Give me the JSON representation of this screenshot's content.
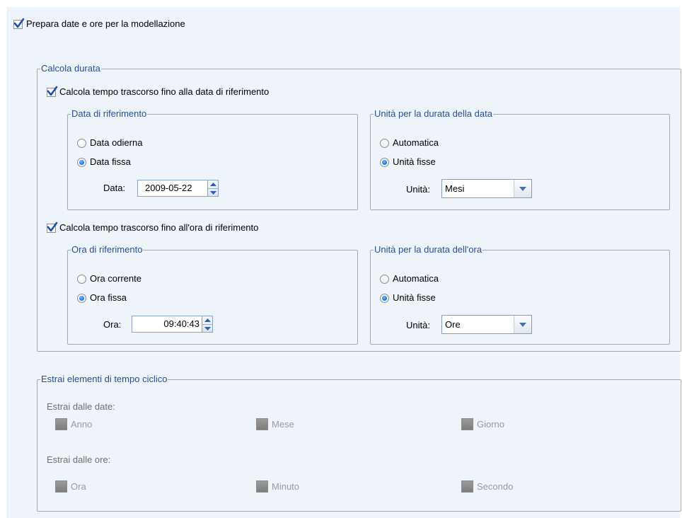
{
  "prepare": {
    "label": "Prepara date e ore per la modellazione",
    "checked": true
  },
  "duration": {
    "legend": "Calcola durata",
    "date_check": {
      "label": "Calcola tempo trascorso fino alla data di riferimento",
      "checked": true
    },
    "ref_date": {
      "legend": "Data di riferimento",
      "opt_today": "Data odierna",
      "opt_fixed": "Data fissa",
      "selected": "Data fissa",
      "field_label": "Data:",
      "value": "2009-05-22"
    },
    "date_units": {
      "legend": "Unità per la durata della data",
      "opt_auto": "Automatica",
      "opt_fixed": "Unità fisse",
      "selected": "Unità fisse",
      "unit_label": "Unità:",
      "unit_value": "Mesi"
    },
    "time_check": {
      "label": "Calcola tempo trascorso fino all'ora di riferimento",
      "checked": true
    },
    "ref_time": {
      "legend": "Ora di riferimento",
      "opt_current": "Ora corrente",
      "opt_fixed": "Ora fissa",
      "selected": "Ora fissa",
      "field_label": "Ora:",
      "value": "09:40:43"
    },
    "time_units": {
      "legend": "Unità per la durata dell'ora",
      "opt_auto": "Automatica",
      "opt_fixed": "Unità fisse",
      "selected": "Unità fisse",
      "unit_label": "Unità:",
      "unit_value": "Ore"
    }
  },
  "cyclic": {
    "legend": "Estrai elementi di tempo ciclico",
    "from_dates": "Estrai dalle date:",
    "dates": [
      "Anno",
      "Mese",
      "Giorno"
    ],
    "from_times": "Estrai dalle ore:",
    "times": [
      "Ora",
      "Minuto",
      "Secondo"
    ]
  },
  "colors": {
    "legend_text": "#2a4f8e",
    "panel_bg": "#eff3fa",
    "check": "#1f4fa8",
    "disabled_text": "#9a9a9a"
  }
}
